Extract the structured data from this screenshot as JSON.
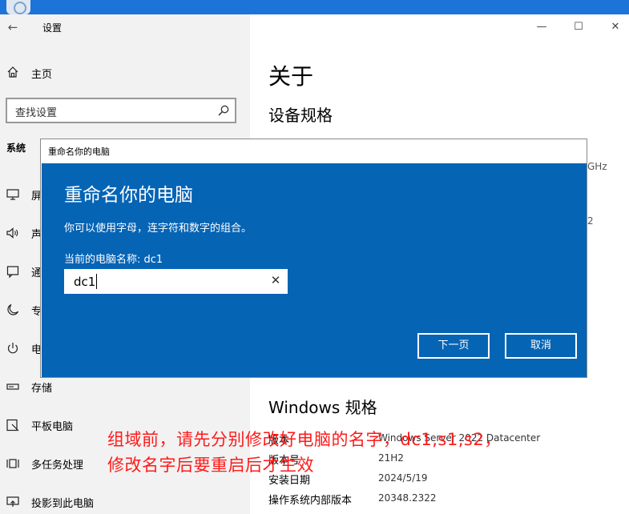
{
  "window": {
    "title": "设置"
  },
  "sidebar": {
    "home_label": "主页",
    "search_placeholder": "查找设置",
    "section_title": "系统",
    "items": [
      {
        "label": "屏",
        "icon": "monitor-icon"
      },
      {
        "label": "声",
        "icon": "speaker-icon"
      },
      {
        "label": "通",
        "icon": "notification-icon"
      },
      {
        "label": "专",
        "icon": "moon-icon"
      },
      {
        "label": "电",
        "icon": "power-icon"
      },
      {
        "label": "存储",
        "icon": "storage-icon"
      },
      {
        "label": "平板电脑",
        "icon": "tablet-icon"
      },
      {
        "label": "多任务处理",
        "icon": "multitask-icon"
      },
      {
        "label": "投影到此电脑",
        "icon": "project-icon"
      }
    ]
  },
  "main": {
    "title": "关于",
    "device_spec_title": "设备规格",
    "partial_1": "GHz",
    "partial_2": "2",
    "windows_spec_title": "Windows 规格",
    "specs": [
      {
        "label": "版本",
        "value": "Windows Server 2022 Datacenter"
      },
      {
        "label": "版本号",
        "value": "21H2"
      },
      {
        "label": "安装日期",
        "value": "2024/5/19"
      },
      {
        "label": "操作系统内部版本",
        "value": "20348.2322"
      }
    ]
  },
  "dialog": {
    "window_title": "重命名你的电脑",
    "heading": "重命名你的电脑",
    "description": "你可以使用字母，连字符和数字的组合。",
    "current_name": "当前的电脑名称: dc1",
    "input_value": "dc1",
    "next_label": "下一页",
    "cancel_label": "取消"
  },
  "annotation": {
    "line1": "组域前，请先分别修改好电脑的名字，dc1,s1,s2，",
    "line2": "修改名字后要重启后才生效",
    "color": "#ff1a1a"
  },
  "colors": {
    "dialog_blue": "#0664b5",
    "taskbar_blue": "#1c73d8"
  }
}
